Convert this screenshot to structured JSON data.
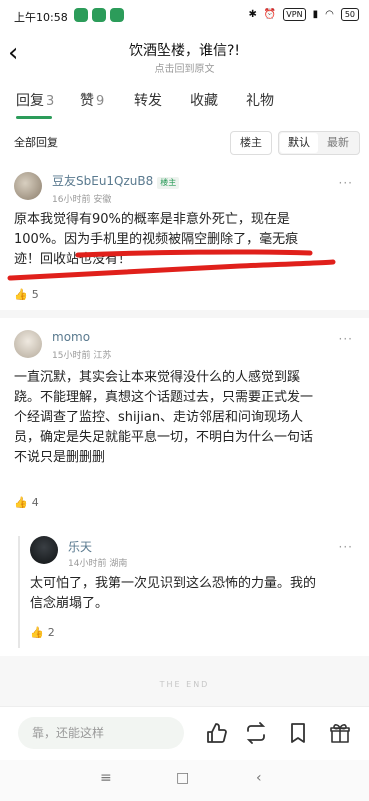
{
  "status_bar": {
    "time": "上午10:58",
    "vpn": "VPN",
    "battery": "50"
  },
  "header": {
    "title": "饮酒坠楼，谁信?!",
    "subtitle": "点击回到原文"
  },
  "tabs": [
    {
      "label": "回复",
      "count": "3"
    },
    {
      "label": "赞",
      "count": "9"
    },
    {
      "label": "转发",
      "count": ""
    },
    {
      "label": "收藏",
      "count": ""
    },
    {
      "label": "礼物",
      "count": ""
    }
  ],
  "sort": {
    "all_label": "全部回复",
    "louzhu": "楼主",
    "default": "默认",
    "latest": "最新"
  },
  "comments": [
    {
      "user": "豆友SbEu1QzuB8",
      "badge": "楼主",
      "meta": "16小时前 安徽",
      "lines": [
        "原本我觉得有90%的概率是非意外死亡，现在是",
        "100%。因为手机里的视频被隔空删除了，毫无痕",
        "迹！回收站也没有！"
      ],
      "likes": "5"
    },
    {
      "user": "momo",
      "meta": "15小时前 江苏",
      "lines": [
        "一直沉默，其实会让本来觉得没什么的人感觉到蹊",
        "跷。不能理解，真想这个话题过去，只需要正式发一",
        "个经调查了监控、shijian、走访邻居和问询现场人",
        "员，确定是失足就能平息一切，不明白为什么一句话",
        "不说只是删删删"
      ],
      "likes": "4"
    },
    {
      "user": "乐天",
      "meta": "14小时前 湖南",
      "lines": [
        "太可怕了，我第一次见识到这么恐怖的力量。我的",
        "信念崩塌了。"
      ],
      "likes": "2"
    }
  ],
  "the_end": "THE END",
  "bottom_bar": {
    "input_placeholder": "靠，还能这样"
  },
  "colors": {
    "accent": "#2c9c5a",
    "username": "#5a7a8f",
    "annotation": "#e0201b"
  }
}
